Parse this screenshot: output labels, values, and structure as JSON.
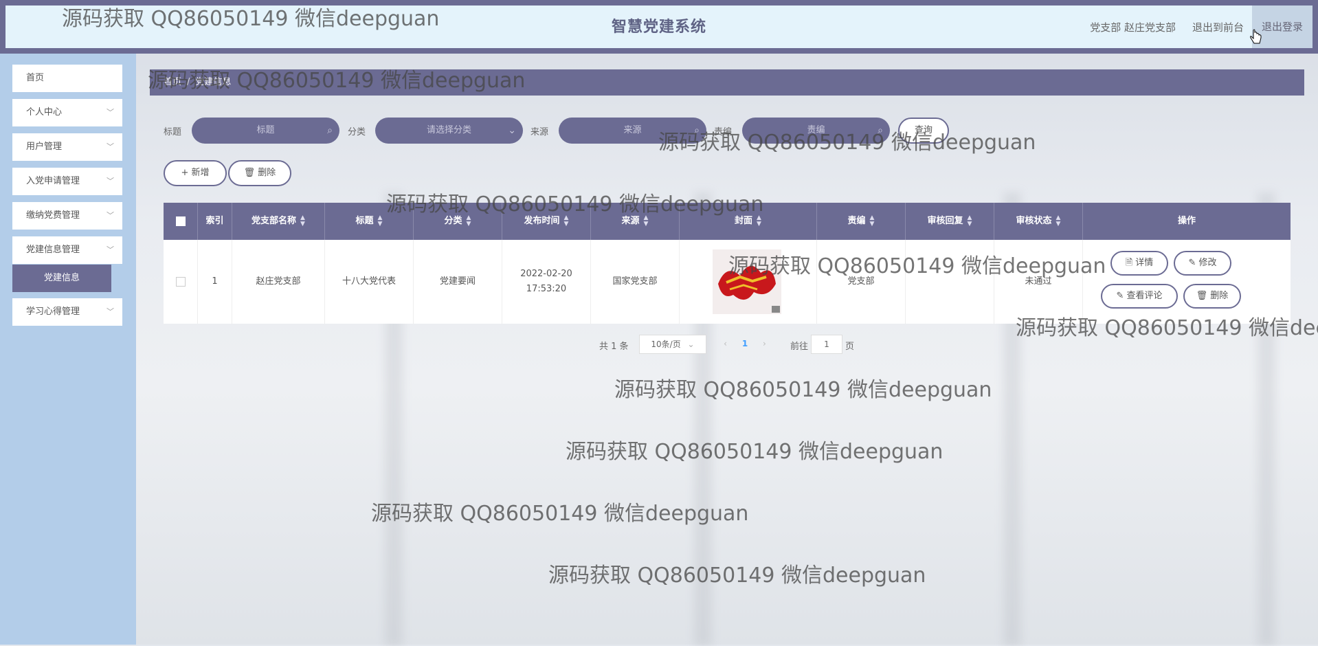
{
  "app": {
    "title": "智慧党建系统"
  },
  "header": {
    "user": "党支部 赵庄党支部",
    "front_label": "退出到前台",
    "logout_label": "退出登录"
  },
  "sidebar": {
    "items": [
      {
        "label": "首页"
      },
      {
        "label": "个人中心",
        "chevron": "﹀"
      },
      {
        "label": "用户管理",
        "chevron": "﹀"
      },
      {
        "label": "入党申请管理",
        "chevron": "﹀"
      },
      {
        "label": "缴纳党费管理",
        "chevron": "﹀"
      },
      {
        "label": "党建信息管理",
        "chevron": "﹀"
      },
      {
        "label": "学习心得管理",
        "chevron": "﹀"
      }
    ],
    "active_sub": "党建信息"
  },
  "breadcrumb": {
    "home": "首页",
    "sep": "/",
    "current": "党建信息"
  },
  "search": {
    "title_label": "标题",
    "title_placeholder": "标题",
    "category_label": "分类",
    "category_placeholder": "请选择分类",
    "source_label": "来源",
    "source_placeholder": "来源",
    "editor_label": "责编",
    "editor_placeholder": "责编",
    "query_button": "查询"
  },
  "actions": {
    "add": "+ 新增",
    "delete": "🗑 删除"
  },
  "table": {
    "columns": [
      "索引",
      "党支部名称",
      "标题",
      "分类",
      "发布时间",
      "来源",
      "封面",
      "责编",
      "审核回复",
      "审核状态",
      "操作"
    ],
    "rows": [
      {
        "index": "1",
        "branch": "赵庄党支部",
        "title": "十八大党代表",
        "category": "党建要闻",
        "time": "2022-02-20 17:53:20",
        "source": "国家党支部",
        "editor": "党支部",
        "reply": "",
        "status": "未通过"
      }
    ],
    "ops": {
      "detail": "🗎 详情",
      "edit": "✎ 修改",
      "comments": "✎ 查看评论",
      "delete": "🗑 删除"
    }
  },
  "pagination": {
    "total": "共 1 条",
    "page_size": "10条/页",
    "current": "1",
    "goto_label": "前往",
    "goto_value": "1",
    "page_unit": "页"
  },
  "watermark": "源码获取 QQ86050149 微信deepguan"
}
